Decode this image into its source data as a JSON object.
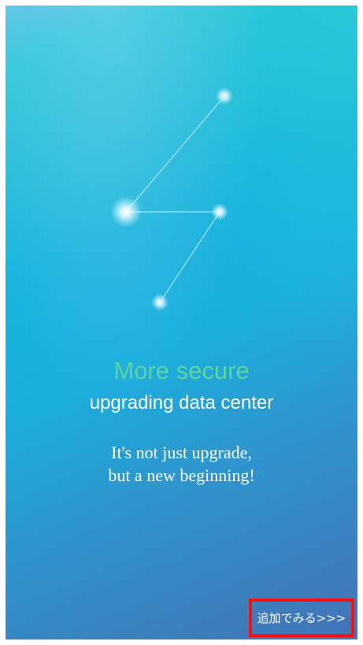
{
  "content": {
    "title": "More secure",
    "subtitle": "upgrading data center",
    "tagline_line1": "It's not just upgrade,",
    "tagline_line2": "but a new beginning!"
  },
  "action": {
    "add_label": "追加でみる>>>"
  },
  "colors": {
    "title": "#5ed39e",
    "text": "#ffffff",
    "highlight_border": "#ff1010",
    "background_top": "#2cc6d9",
    "background_bottom": "#4283c0"
  },
  "graphics": {
    "constellation": "star-constellation-icon"
  }
}
